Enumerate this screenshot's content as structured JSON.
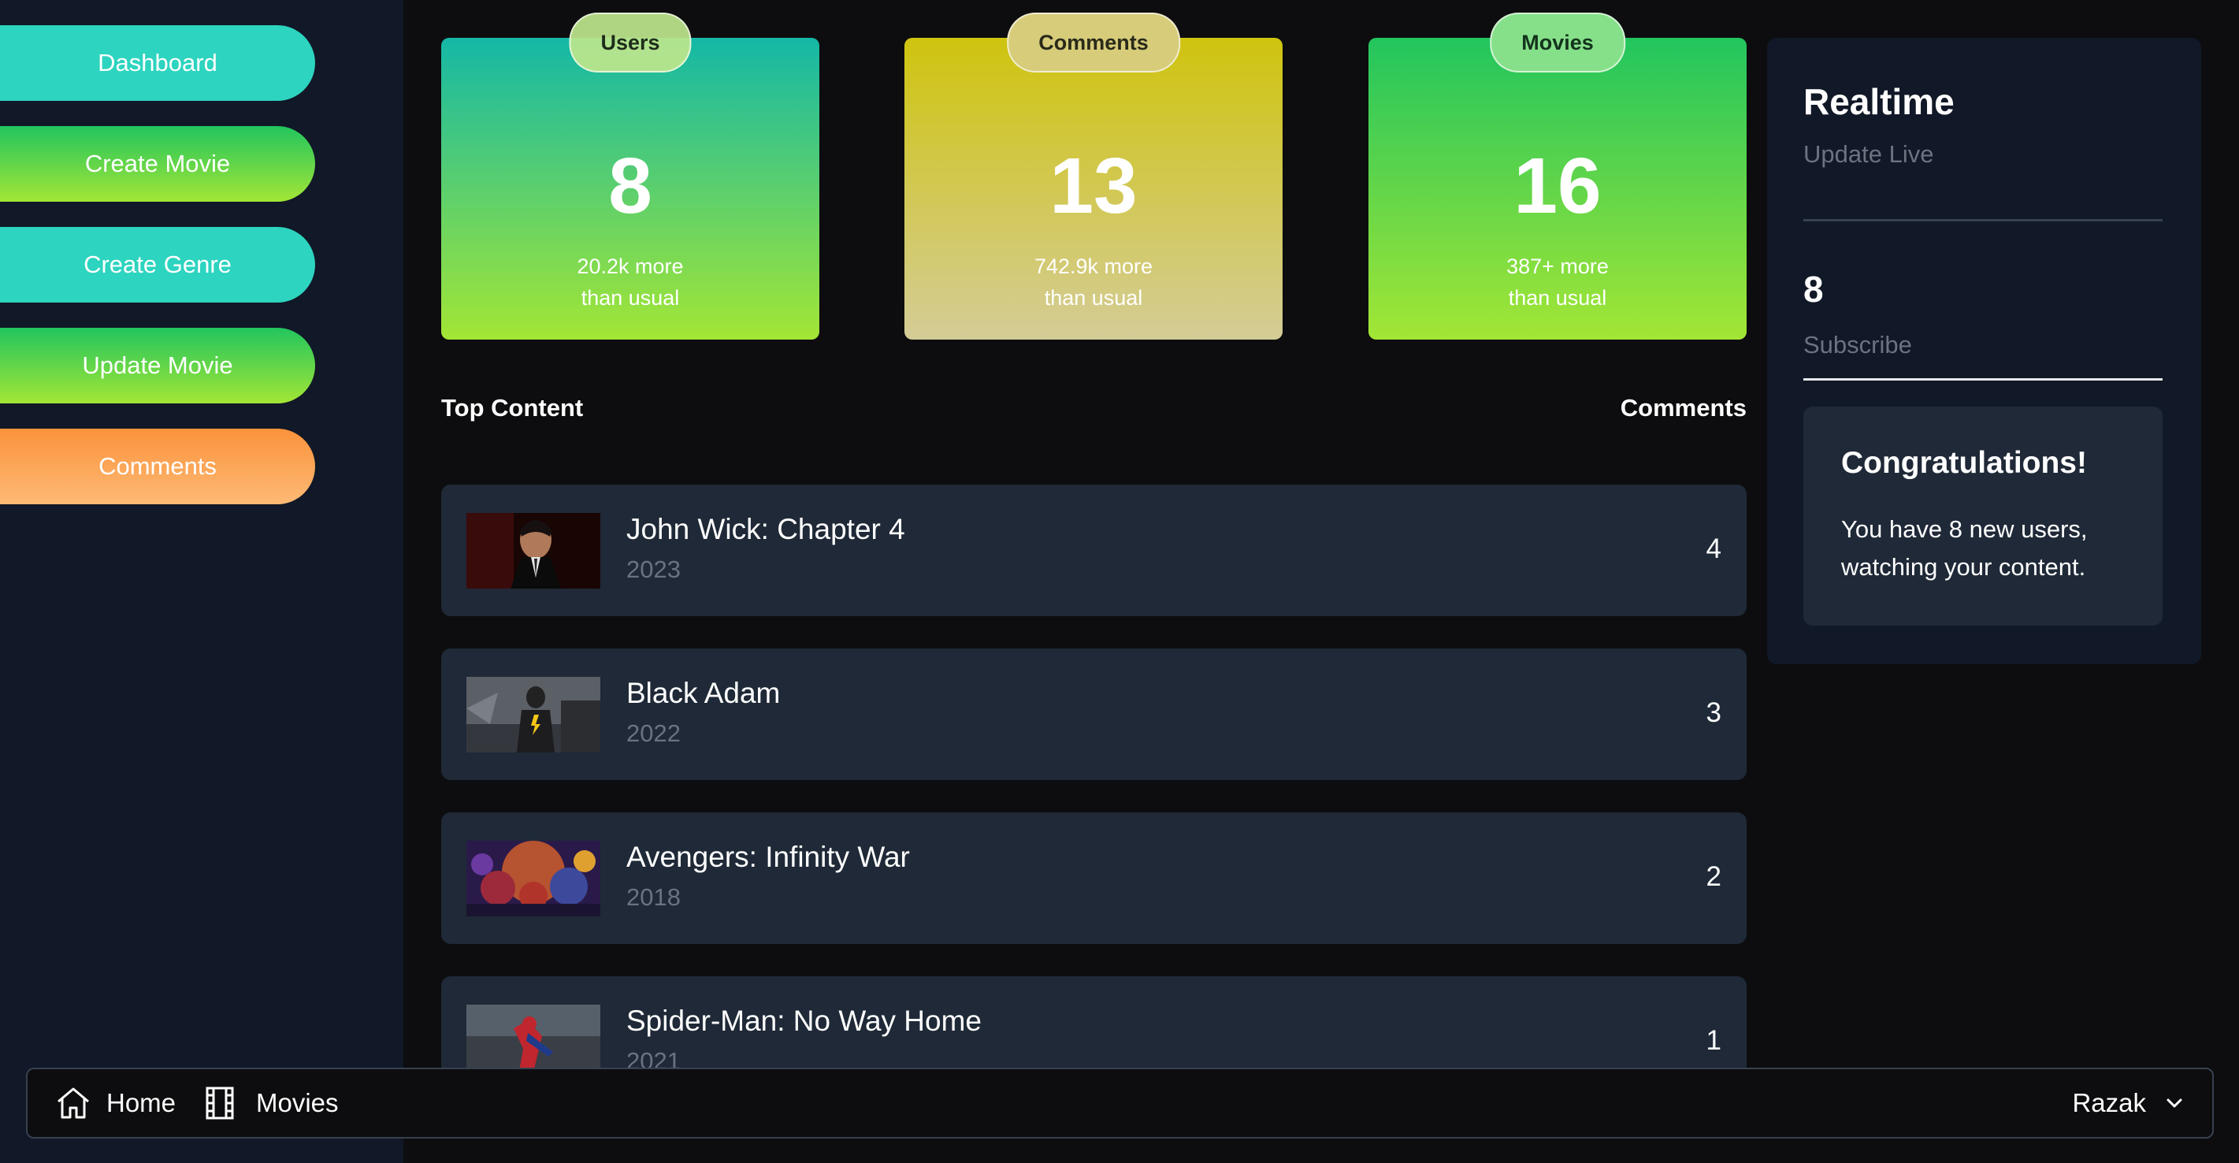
{
  "sidebar": {
    "items": [
      {
        "label": "Dashboard"
      },
      {
        "label": "Create Movie"
      },
      {
        "label": "Create Genre"
      },
      {
        "label": "Update Movie"
      },
      {
        "label": "Comments"
      }
    ]
  },
  "stats": [
    {
      "label": "Users",
      "value": "8",
      "sub_line1": "20.2k more",
      "sub_line2": "than usual"
    },
    {
      "label": "Comments",
      "value": "13",
      "sub_line1": "742.9k more",
      "sub_line2": "than usual"
    },
    {
      "label": "Movies",
      "value": "16",
      "sub_line1": "387+ more",
      "sub_line2": "than usual"
    }
  ],
  "top_content": {
    "title": "Top Content",
    "comments_header": "Comments",
    "rows": [
      {
        "title": "John Wick: Chapter 4",
        "year": "2023",
        "comments": "4"
      },
      {
        "title": "Black Adam",
        "year": "2022",
        "comments": "3"
      },
      {
        "title": "Avengers: Infinity War",
        "year": "2018",
        "comments": "2"
      },
      {
        "title": "Spider-Man: No Way Home",
        "year": "2021",
        "comments": "1"
      }
    ]
  },
  "realtime": {
    "title": "Realtime",
    "subtitle": "Update Live",
    "count": "8",
    "count_label": "Subscribe",
    "congrats_title": "Congratulations!",
    "congrats_text": "You have 8 new users, watching your content."
  },
  "bottom_nav": {
    "home_label": "Home",
    "movies_label": "Movies",
    "user_name": "Razak",
    "icons": [
      "home-icon",
      "film-icon",
      "chevron-down-icon"
    ]
  },
  "colors": {
    "sidebar_bg": "#111827",
    "page_bg": "#0d0d0f",
    "row_bg": "#1f2937",
    "accent_cyan": "#2dd4bf",
    "accent_green": "#22c55e",
    "accent_lime": "#a3e635",
    "accent_yellow": "#cfc40f",
    "accent_orange": "#fb923c"
  }
}
